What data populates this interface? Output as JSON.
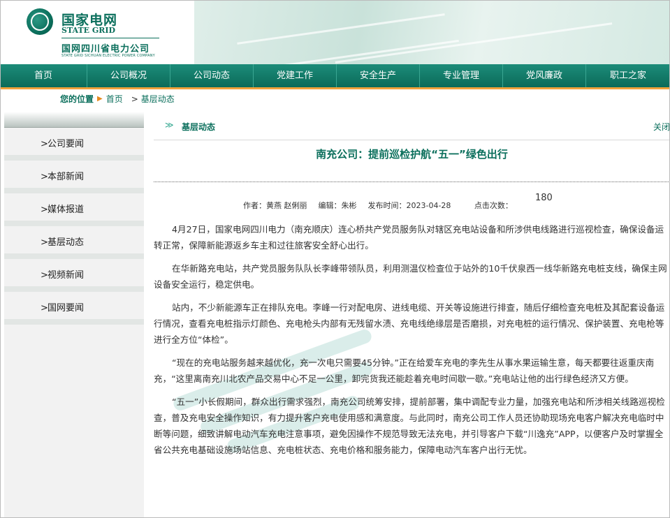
{
  "header": {
    "logo_cn": "国家电网",
    "logo_en": "STATE GRID",
    "company_cn": "国网四川省电力公司",
    "company_en": "STATE GRID SICHUAN ELECTRIC POWER COMPANY"
  },
  "nav": {
    "items": [
      "首页",
      "公司概况",
      "公司动态",
      "党建工作",
      "安全生产",
      "专业管理",
      "党风廉政",
      "职工之家"
    ]
  },
  "breadcrumb": {
    "label": "您的位置",
    "home": "首页",
    "current": "基层动态",
    "separator": ">"
  },
  "sidebar": {
    "items": [
      {
        "label": "公司要闻"
      },
      {
        "label": "本部新闻"
      },
      {
        "label": "媒体报道"
      },
      {
        "label": "基层动态"
      },
      {
        "label": "视频新闻"
      },
      {
        "label": "国网要闻"
      }
    ],
    "arrow": ">"
  },
  "article": {
    "category": "基层动态",
    "close_label": "关闭",
    "title": "南充公司：提前巡检护航“五一”绿色出行",
    "author_label": "作者：黄燕 赵俐丽",
    "editor_label": "编辑：朱彬",
    "date_label": "发布时间：2023-04-28",
    "clicks_label": "点击次数：",
    "clicks_value": "180",
    "paragraphs": [
      "4月27日，国家电网四川电力（南充顺庆）连心桥共产党员服务队对辖区充电站设备和所涉供电线路进行巡视检查，确保设备运转正常，保障新能源返乡车主和过往旅客安全舒心出行。",
      "在华新路充电站，共产党员服务队队长李峰带领队员，利用测温仪检查位于站外的10千伏泉西一线华新路充电桩支线，确保主网设备安全运行，稳定供电。",
      "站内，不少新能源车正在排队充电。李峰一行对配电房、进线电缆、开关等设施进行排查，随后仔细检查充电桩及其配套设备运行情况，查看充电桩指示灯颜色、充电枪头内部有无残留水渍、充电线绝缘层是否磨损，对充电桩的运行情况、保护装置、充电枪等进行全方位“体检”。",
      "“现在的充电站服务越来越优化，充一次电只需要45分钟。”正在给爱车充电的李先生从事水果运输生意，每天都要往返重庆南充，“这里离南充川北农产品交易中心不足一公里，卸完货我还能趁着充电时间歇一歇。”充电站让他的出行绿色经济又方便。",
      "“五一”小长假期间，群众出行需求强烈，南充公司统筹安排，提前部署，集中调配专业力量，加强充电站和所涉相关线路巡视检查，普及充电安全操作知识，有力提升客户充电使用感和满意度。与此同时，南充公司工作人员还协助现场充电客户解决充电临时中断等问题，细致讲解电动汽车充电注意事项，避免因操作不规范导致无法充电，并引导客户下载“川逸充”APP，以便客户及时掌握全省公共充电基础设施场站信息、充电桩状态、充电价格和服务能力，保障电动汽车客户出行无忧。"
    ]
  },
  "colors": {
    "brand_green": "#0b6f5c",
    "nav_accent": "#f0a23b"
  }
}
